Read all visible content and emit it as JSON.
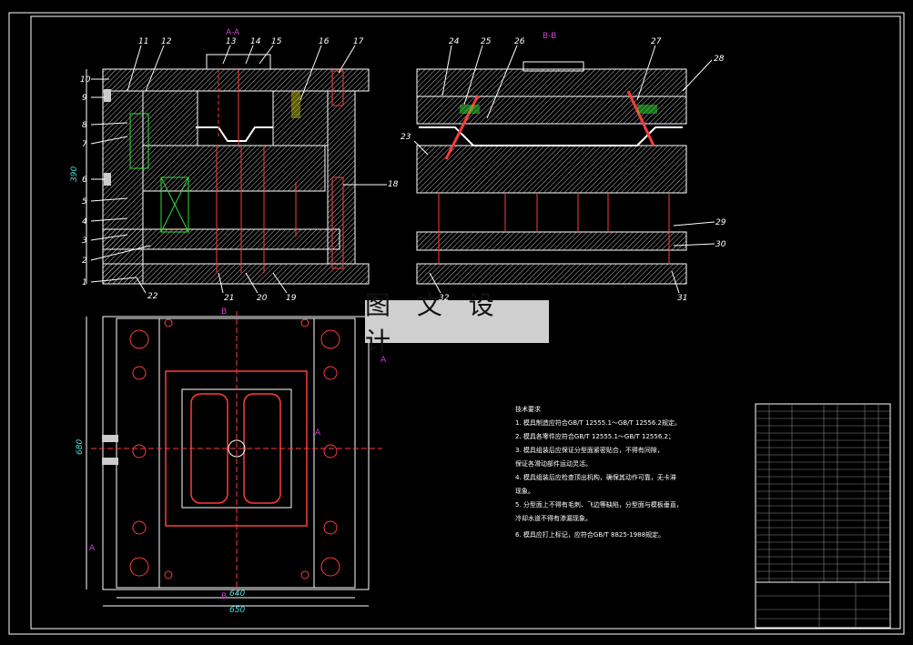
{
  "watermark": "图 文 设 计",
  "sections": {
    "aa": "A-A",
    "bb": "B-B",
    "a": "A",
    "b": "B"
  },
  "callouts_left": [
    "1",
    "2",
    "3",
    "4",
    "5",
    "6",
    "7",
    "8",
    "9",
    "10"
  ],
  "callouts_top_left": [
    "11",
    "12",
    "13",
    "14",
    "15",
    "16",
    "17"
  ],
  "callouts_right_of_left": [
    "18"
  ],
  "callouts_bottom_left": [
    "22",
    "21",
    "20",
    "19"
  ],
  "callouts_top_right": [
    "24",
    "25",
    "26",
    "27",
    "28"
  ],
  "callouts_right": [
    "23",
    "29",
    "30"
  ],
  "callouts_bottom_right": [
    "32",
    "31"
  ],
  "dimensions": {
    "left_height": "390",
    "plan_height": "680",
    "plan_w1": "640",
    "plan_w2": "650"
  },
  "tech_notes_title": "技术要求",
  "tech_notes": [
    "1. 模具制造应符合GB/T 12555.1～GB/T 12556.2规定。",
    "2. 模具各零件应符合GB/T 12555.1～GB/T 12556.2；",
    "3. 模具组装后应保证分型面紧密贴合，不得有间隙，",
    "   保证各滑动部件运动灵活。",
    "4. 模具组装后应检查顶出机构，确保其动作可靠，无卡滞",
    "   现象。",
    "5. 分型面上不得有毛刺、飞边等缺陷，分型面与模板垂直，",
    "   冷却水道不得有渗漏现象。",
    "6. 模具应打上标记，应符合GB/T 8825-1988规定。"
  ],
  "colors": {
    "line": "#ffffff",
    "red": "#ff3b3b",
    "green": "#30e030",
    "magenta": "#d040d0",
    "yellow": "#e0e000",
    "cyan": "#40e0e0"
  }
}
